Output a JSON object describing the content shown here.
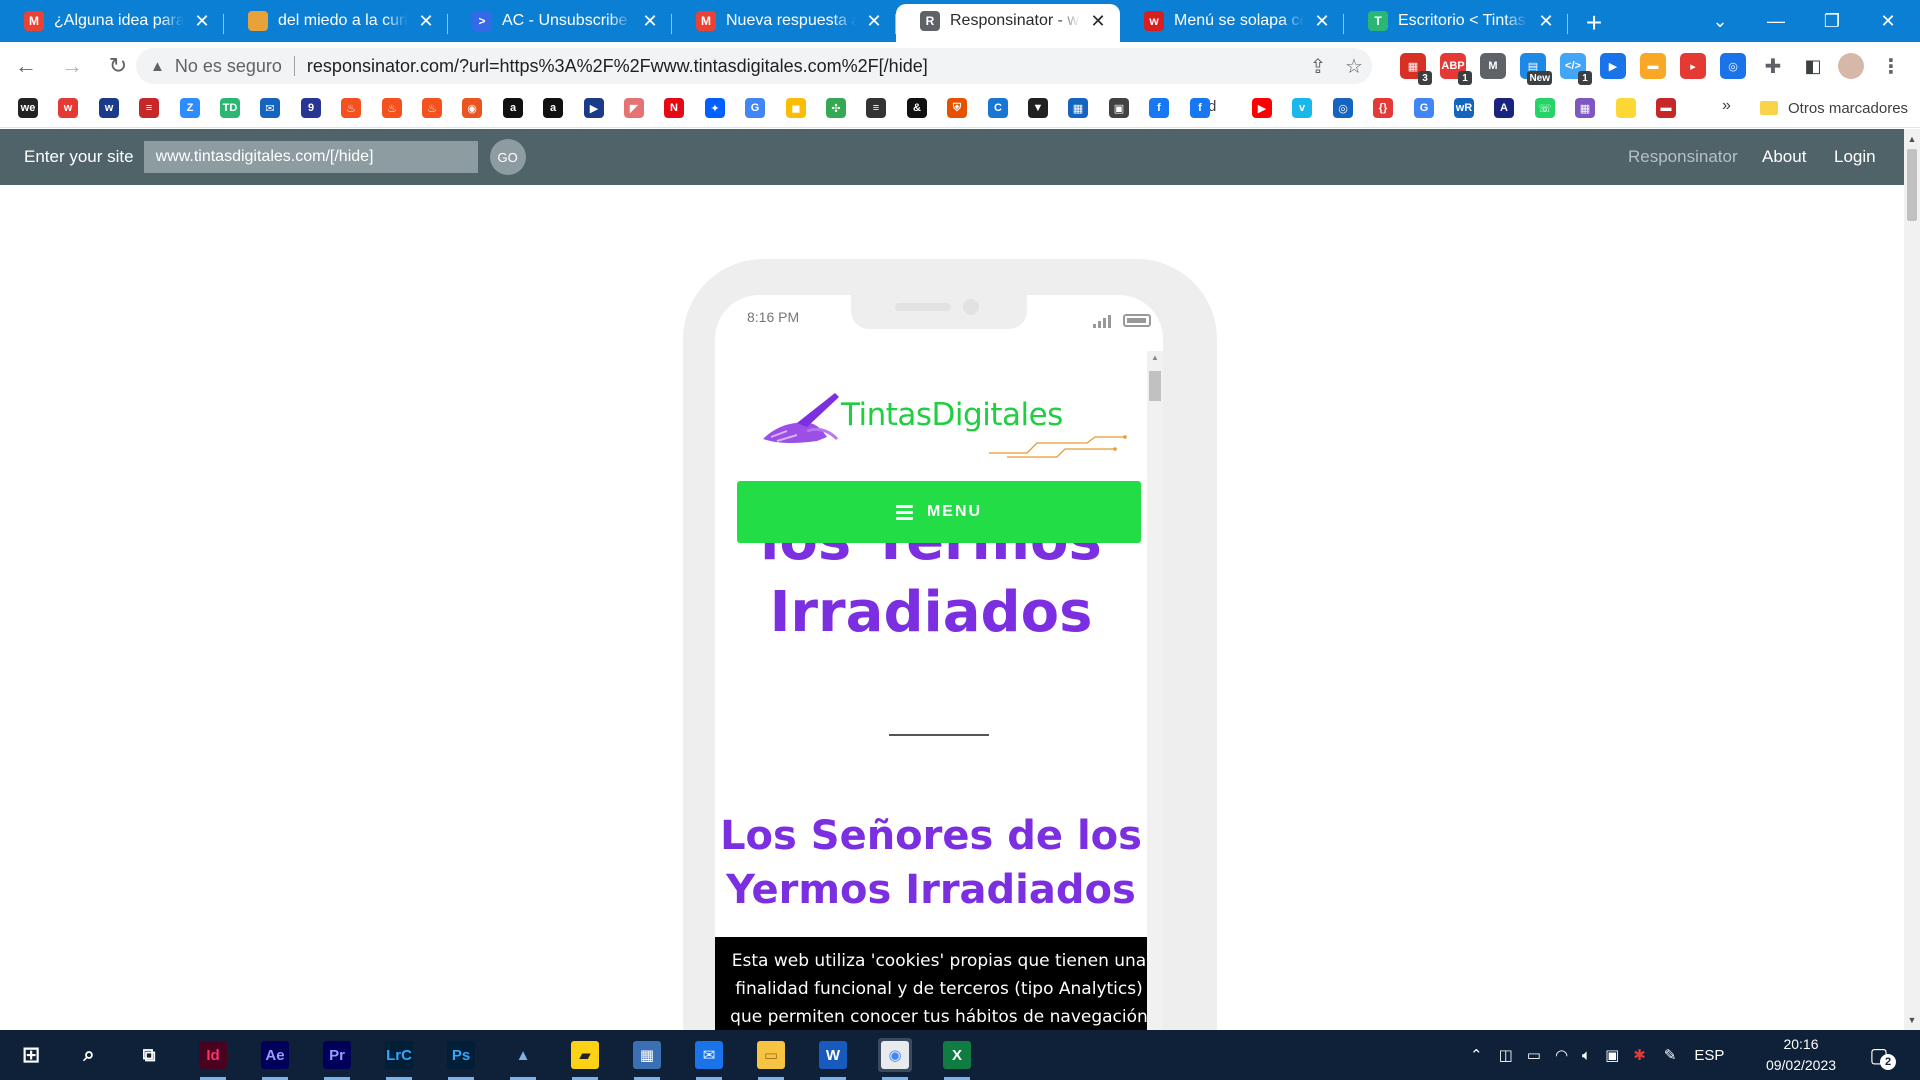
{
  "browser": {
    "tabs": [
      {
        "title": "¿Alguna idea para est",
        "favicon": "gmail-icon",
        "color": "#ea4335",
        "letter": "M"
      },
      {
        "title": "del miedo a la curiosi",
        "favicon": "globe-icon",
        "color": "#e8a23a",
        "letter": ""
      },
      {
        "title": "AC - Unsubscribe",
        "favicon": "activecampaign-icon",
        "color": "#356ae6",
        "letter": ">"
      },
      {
        "title": "Nueva respuesta a: M",
        "favicon": "gmail-icon",
        "color": "#ea4335",
        "letter": "M"
      },
      {
        "title": "Responsinator - www.",
        "favicon": "responsinator-icon",
        "color": "#5f6368",
        "letter": "R"
      },
      {
        "title": "Menú se solapa con p",
        "favicon": "wordpress-forum-icon",
        "color": "#d81e1e",
        "letter": "w"
      },
      {
        "title": "Escritorio < Tintas Dig",
        "favicon": "tintas-digitales-icon",
        "color": "#2bb673",
        "letter": "T"
      }
    ],
    "active_tab_index": 4,
    "new_tab_label": "+",
    "address": {
      "security_label": "No es seguro",
      "url": "responsinator.com/?url=https%3A%2F%2Fwww.tintasdigitales.com%2F[/hide]"
    },
    "extensions": [
      {
        "name": "calendar-ext-icon",
        "color": "#d93025",
        "label": "▦",
        "badge": "3"
      },
      {
        "name": "adblock-ext-icon",
        "color": "#e53935",
        "label": "ABP",
        "badge": "1"
      },
      {
        "name": "gmail-ext-icon",
        "color": "#5f6368",
        "label": "M",
        "badge": ""
      },
      {
        "name": "news-ext-icon",
        "color": "#1e88e5",
        "label": "▤",
        "badge": "New"
      },
      {
        "name": "code-ext-icon",
        "color": "#42a5f5",
        "label": "</>",
        "badge": "1"
      },
      {
        "name": "video-ext-icon",
        "color": "#1a73e8",
        "label": "▶",
        "badge": ""
      },
      {
        "name": "pocket-ext-icon",
        "color": "#f9a825",
        "label": "▬",
        "badge": ""
      },
      {
        "name": "youtube-ext-icon",
        "color": "#e53935",
        "label": "▸",
        "badge": ""
      },
      {
        "name": "sync-ext-icon",
        "color": "#1a73e8",
        "label": "◎",
        "badge": ""
      }
    ],
    "bookmarks": [
      {
        "name": "we-bookmark-icon",
        "color": "#222222",
        "label": "we"
      },
      {
        "name": "wattpad-bookmark-icon",
        "color": "#e53935",
        "label": "w"
      },
      {
        "name": "w-circle-bookmark-icon",
        "color": "#1a3a8a",
        "label": "w"
      },
      {
        "name": "site-bookmark-icon",
        "color": "#c62828",
        "label": "≡"
      },
      {
        "name": "zoom-bookmark-icon",
        "color": "#2d8cff",
        "label": "Z"
      },
      {
        "name": "td-bookmark-icon",
        "color": "#2bb673",
        "label": "TD"
      },
      {
        "name": "mail-bookmark-icon",
        "color": "#1565c0",
        "label": "✉"
      },
      {
        "name": "doc-bookmark-icon",
        "color": "#283593",
        "label": "9"
      },
      {
        "name": "fire1-bookmark-icon",
        "color": "#f4511e",
        "label": "♨"
      },
      {
        "name": "fire2-bookmark-icon",
        "color": "#f4511e",
        "label": "♨"
      },
      {
        "name": "fire3-bookmark-icon",
        "color": "#f4511e",
        "label": "♨"
      },
      {
        "name": "ubuntu-bookmark-icon",
        "color": "#e95420",
        "label": "◉"
      },
      {
        "name": "amazon1-bookmark-icon",
        "color": "#111111",
        "label": "a"
      },
      {
        "name": "amazon2-bookmark-icon",
        "color": "#111111",
        "label": "a"
      },
      {
        "name": "play-bookmark-icon",
        "color": "#1a3a8a",
        "label": "▶"
      },
      {
        "name": "red-corner-bookmark-icon",
        "color": "#e57373",
        "label": "◤"
      },
      {
        "name": "netflix-bookmark-icon",
        "color": "#e50914",
        "label": "N"
      },
      {
        "name": "dropbox-bookmark-icon",
        "color": "#0061ff",
        "label": "✦"
      },
      {
        "name": "google-bookmark-icon",
        "color": "#4285f4",
        "label": "G"
      },
      {
        "name": "keep-bookmark-icon",
        "color": "#fbbc04",
        "label": "◼"
      },
      {
        "name": "pinwheel-bookmark-icon",
        "color": "#34a853",
        "label": "✣"
      },
      {
        "name": "circle-lines-bookmark-icon",
        "color": "#333333",
        "label": "≡"
      },
      {
        "name": "ampersand-bookmark-icon",
        "color": "#111111",
        "label": "&"
      },
      {
        "name": "shield-bookmark-icon",
        "color": "#e65100",
        "label": "⛨"
      },
      {
        "name": "c-bookmark-icon",
        "color": "#1976d2",
        "label": "C"
      },
      {
        "name": "bookmark-dark-icon",
        "color": "#212121",
        "label": "▼"
      },
      {
        "name": "calendar-bookmark-icon",
        "color": "#1565c0",
        "label": "▦"
      },
      {
        "name": "image-bookmark-icon",
        "color": "#424242",
        "label": "▣"
      },
      {
        "name": "facebook1-bookmark-icon",
        "color": "#1877f2",
        "label": "f"
      },
      {
        "name": "facebook2-bookmark-icon",
        "color": "#1877f2",
        "label": "f"
      },
      {
        "name": "youtube-bookmark-icon",
        "color": "#ff0000",
        "label": "▶"
      },
      {
        "name": "vimeo-bookmark-icon",
        "color": "#1ab7ea",
        "label": "v"
      },
      {
        "name": "ring-bookmark-icon",
        "color": "#1565c0",
        "label": "◎"
      },
      {
        "name": "braces-bookmark-icon",
        "color": "#e53935",
        "label": "{}"
      },
      {
        "name": "translate-bookmark-icon",
        "color": "#4285f4",
        "label": "G"
      },
      {
        "name": "wordreference-bookmark-icon",
        "color": "#1565c0",
        "label": "wR"
      },
      {
        "name": "hacienda-bookmark-icon",
        "color": "#1a237e",
        "label": "A"
      },
      {
        "name": "whatsapp-bookmark-icon",
        "color": "#25d366",
        "label": "☏"
      },
      {
        "name": "grid-bookmark-icon",
        "color": "#7e57c2",
        "label": "▦"
      },
      {
        "name": "note-bookmark-icon",
        "color": "#fdd835",
        "label": " "
      },
      {
        "name": "toolbox-bookmark-icon",
        "color": "#c62828",
        "label": "▬"
      }
    ],
    "bookmark_d_label": "d",
    "bookmarks_overflow": "»",
    "other_bookmarks": "Otros marcadores"
  },
  "responsinator": {
    "enter_label": "Enter your site",
    "site_value": "www.tintasdigitales.com/[/hide]",
    "go_label": "GO",
    "nav": [
      "Responsinator",
      "About",
      "Login"
    ]
  },
  "phone": {
    "time": "8:16 PM"
  },
  "site": {
    "logo_text": "TintasDigitales",
    "menu_label": "MENU",
    "title_line1": "los Yermos",
    "title_line2": "Irradiados",
    "subtitle_line1": "Los Señores de los",
    "subtitle_line2": "Yermos Irradiados",
    "cookie_text": "Esta web utiliza 'cookies' propias que tienen una finalidad funcional y de terceros (tipo Analytics) que permiten conocer tus hábitos de navegación para darte mejores"
  },
  "taskbar": {
    "apps": [
      {
        "name": "indesign-app-icon",
        "label": "Id",
        "bg": "#49021f",
        "fg": "#ff3366"
      },
      {
        "name": "aftereffects-app-icon",
        "label": "Ae",
        "bg": "#00005b",
        "fg": "#9999ff"
      },
      {
        "name": "premiere-app-icon",
        "label": "Pr",
        "bg": "#00005b",
        "fg": "#9999ff"
      },
      {
        "name": "lightroom-classic-app-icon",
        "label": "LrC",
        "bg": "#001e36",
        "fg": "#31a8ff"
      },
      {
        "name": "photoshop-app-icon",
        "label": "Ps",
        "bg": "#001e36",
        "fg": "#31a8ff"
      },
      {
        "name": "affinity-app-icon",
        "label": "▲",
        "bg": "#0e2138",
        "fg": "#7fb2e5"
      },
      {
        "name": "sticky-notes-app-icon",
        "label": "▰",
        "bg": "#fcd116",
        "fg": "#222222"
      },
      {
        "name": "calculator-app-icon",
        "label": "▦",
        "bg": "#3b6fb4",
        "fg": "#ffffff"
      },
      {
        "name": "mail-app-icon",
        "label": "✉",
        "bg": "#1a73e8",
        "fg": "#ffffff"
      },
      {
        "name": "file-explorer-app-icon",
        "label": "▭",
        "bg": "#f6c343",
        "fg": "#a0711a"
      },
      {
        "name": "word-app-icon",
        "label": "W",
        "bg": "#185abd",
        "fg": "#ffffff"
      },
      {
        "name": "chrome-app-icon",
        "label": "◉",
        "bg": "#e8eaed",
        "fg": "#4285f4"
      },
      {
        "name": "excel-app-icon",
        "label": "X",
        "bg": "#107c41",
        "fg": "#ffffff"
      }
    ],
    "language": "ESP",
    "time": "20:16",
    "date": "09/02/2023",
    "notification_count": "2"
  }
}
